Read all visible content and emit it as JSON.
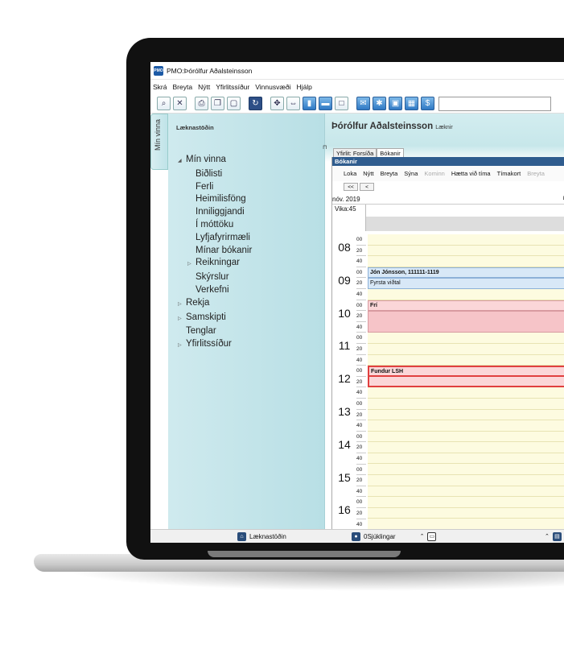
{
  "window": {
    "app_icon": "PMO",
    "title": "PMO:Þórólfur Aðalsteinsson"
  },
  "menubar": [
    "Skrá",
    "Breyta",
    "Nýtt",
    "Yfirlitssíður",
    "Vinnusvæði",
    "Hjálp"
  ],
  "toolbar_icons": [
    "search-doc-icon",
    "close-doc-icon",
    "print-icon",
    "copy-icon",
    "paste-icon",
    "refresh-icon",
    "expand-icon",
    "resize-icon",
    "split-vertical-icon",
    "split-horizontal-icon",
    "window-icon",
    "mail-icon",
    "network-icon",
    "image-icon",
    "calendar-icon",
    "dollar-icon"
  ],
  "sidebar": {
    "vertical_tab": "Mín vinna",
    "clinic": "Læknastöðin",
    "tree": [
      {
        "label": "Mín vinna",
        "level": 0,
        "expander": "◢"
      },
      {
        "label": "Biðlisti",
        "level": 1
      },
      {
        "label": "Ferli",
        "level": 1
      },
      {
        "label": "Heimilisföng",
        "level": 1
      },
      {
        "label": "Inniliggjandi",
        "level": 1
      },
      {
        "label": "Í móttöku",
        "level": 1
      },
      {
        "label": "Lyfjafyrirmæli",
        "level": 1
      },
      {
        "label": "Mínar bókanir",
        "level": 1
      },
      {
        "label": "Reikningar",
        "level": 2,
        "expander": "▷"
      },
      {
        "label": "Skýrslur",
        "level": 1
      },
      {
        "label": "Verkefni",
        "level": 1
      },
      {
        "label": "Rekja",
        "level": 0,
        "expander": "▷"
      },
      {
        "label": "Samskipti",
        "level": 0,
        "expander": "▷"
      },
      {
        "label": "Tenglar",
        "level": 0
      },
      {
        "label": "Yfirlitssíður",
        "level": 0,
        "expander": "▷"
      }
    ]
  },
  "patient": {
    "name": "Þórólfur Aðalsteinsson",
    "role": "Læknir"
  },
  "tabs": [
    "Yfirlit: Forsíða",
    "Bókanir"
  ],
  "bookings": {
    "title": "Bókanir",
    "menu": [
      "Loka",
      "Nýtt",
      "Breyta",
      "Sýna",
      "Kominn",
      "Hætta við tíma",
      "Tímakort",
      "Breyta"
    ],
    "nav": [
      "<<",
      "<"
    ],
    "date": "nóv. 2019",
    "date_right": "Læ",
    "week": "Vika:45",
    "hours": [
      "08",
      "09",
      "10",
      "11",
      "12",
      "13",
      "14",
      "15",
      "16"
    ],
    "minutes": [
      "00",
      "20",
      "40"
    ],
    "appointments": [
      {
        "text": "Jón Jónsson, 111111-1119",
        "bold": true
      },
      {
        "text": "Fyrsta viðtal",
        "bold": false
      },
      {
        "text": "Frí",
        "bold": true
      },
      {
        "text": "Fundur LSH",
        "bold": true
      }
    ]
  },
  "statusbar": {
    "clinic": "Læknastöðin",
    "patients": "0Sjúklingar"
  }
}
